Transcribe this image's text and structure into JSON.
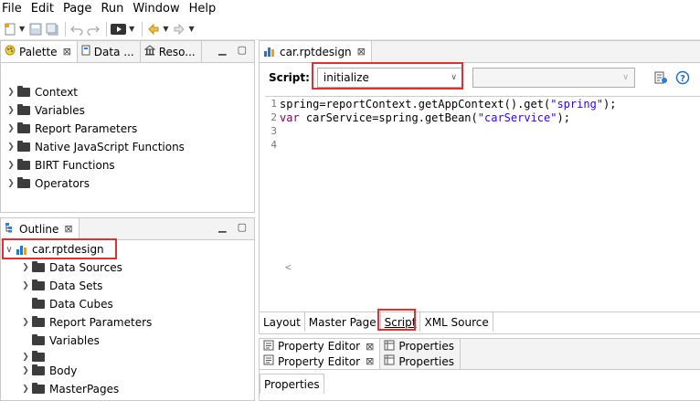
{
  "menubar": {
    "items": [
      "File",
      "Edit",
      "Page",
      "Run",
      "Window",
      "Help"
    ]
  },
  "palette_panel": {
    "tabs": [
      {
        "label": "Palette",
        "close": "⊠"
      },
      {
        "label": "Data ..."
      },
      {
        "label": "Reso..."
      }
    ],
    "items": [
      "Context",
      "Variables",
      "Report Parameters",
      "Native JavaScript Functions",
      "BIRT Functions",
      "Operators"
    ]
  },
  "outline_panel": {
    "tab_label": "Outline",
    "root": "car.rptdesign",
    "children": [
      {
        "label": "Data Sources",
        "expandable": true
      },
      {
        "label": "Data Sets",
        "expandable": true
      },
      {
        "label": "Data Cubes",
        "expandable": false
      },
      {
        "label": "Report Parameters",
        "expandable": true
      },
      {
        "label": "Variables",
        "expandable": false
      },
      {
        "label": "Body",
        "expandable": true
      },
      {
        "label": "MasterPages",
        "expandable": true
      }
    ]
  },
  "editor": {
    "tab_label": "car.rptdesign",
    "script_label": "Script:",
    "script_event": "initialize",
    "code_lines": [
      {
        "num": "1",
        "pre": "spring=reportContext.getAppContext().get(",
        "str": "\"spring\"",
        "post": ");"
      },
      {
        "num": "2",
        "kw": "var",
        "pre": " carService=spring.getBean(",
        "str": "\"carService\"",
        "post": ");"
      },
      {
        "num": "3"
      },
      {
        "num": "4"
      }
    ],
    "bottom_tabs": [
      "Layout",
      "Master Page",
      "Script",
      "XML Source"
    ]
  },
  "property_panel": {
    "tabs": [
      "Property Editor",
      "Properties"
    ],
    "tabs_row2": [
      "Property Editor",
      "Properties"
    ],
    "subtab": "Properties"
  },
  "colors": {
    "highlight": "#e03030",
    "chart_icon": "#1f77d4",
    "chart_icon_alt": "#f0a020"
  }
}
